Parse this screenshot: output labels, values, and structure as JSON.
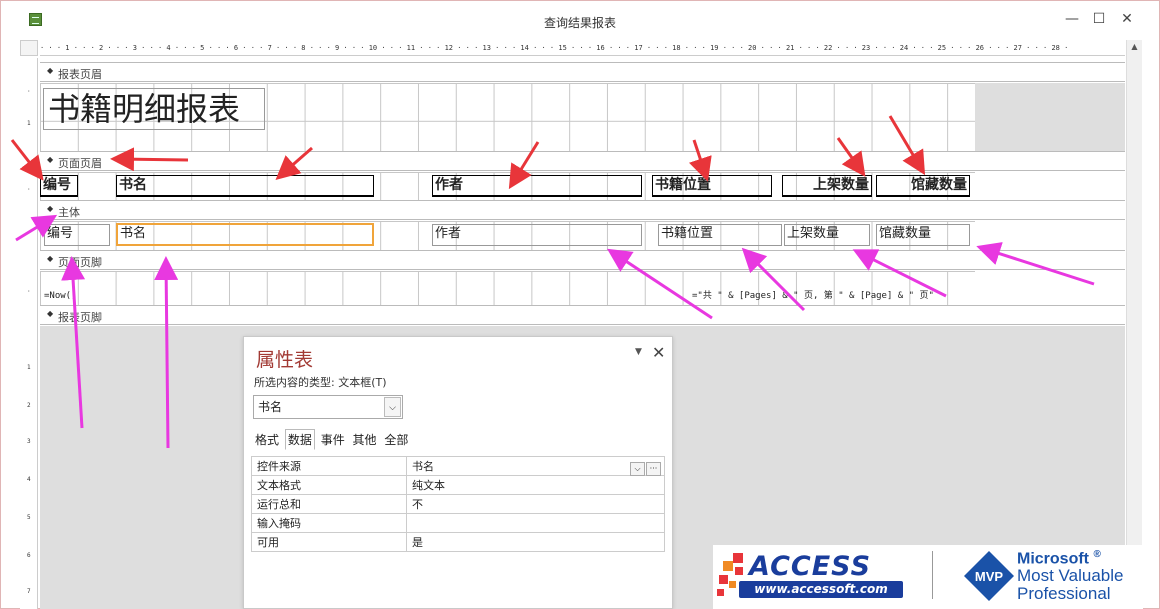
{
  "window": {
    "title": "查询结果报表",
    "minimize_glyph": "—",
    "maximize_glyph": "☐",
    "close_glyph": "✕"
  },
  "ruler": {
    "marks": "· · · 1 · · · 2 · · · 3 · · · 4 · · · 5 · · · 6 · · · 7 · · · 8 · · · 9 · · · 10 · · · 11 · · · 12 · · · 13 · · · 14 · · · 15 · · · 16 · · · 17 · · · 18 · · · 19 · · · 20 · · · 21 · · · 22 · · · 23 · · · 24 · · · 25 · · · 26 · · · 27 · · · 28 ·"
  },
  "sections": {
    "report_header": "报表页眉",
    "page_header": "页面页眉",
    "detail": "主体",
    "page_footer": "页面页脚",
    "report_footer": "报表页脚"
  },
  "report": {
    "title": "书籍明细报表"
  },
  "page_header_labels": {
    "id": "编号",
    "name": "书名",
    "author": "作者",
    "location": "书籍位置",
    "shelved": "上架数量",
    "stock": "馆藏数量"
  },
  "detail_fields": {
    "id": "编号",
    "name": "书名",
    "author": "作者",
    "location": "书籍位置",
    "shelved": "上架数量",
    "stock": "馆藏数量"
  },
  "page_footer": {
    "now_expr": "=Now()",
    "page_expr": "=\"共 \" & [Pages] & \" 页, 第 \" & [Page] & \" 页\""
  },
  "property_sheet": {
    "title": "属性表",
    "selection_type": "所选内容的类型: 文本框(T)",
    "selected_control": "书名",
    "pin_glyph": "▼",
    "close_glyph": "✕",
    "tabs": [
      "格式",
      "数据",
      "事件",
      "其他",
      "全部"
    ],
    "active_tab": "数据",
    "rows": [
      {
        "name": "控件来源",
        "value": "书名"
      },
      {
        "name": "文本格式",
        "value": "纯文本"
      },
      {
        "name": "运行总和",
        "value": "不"
      },
      {
        "name": "输入掩码",
        "value": ""
      },
      {
        "name": "可用",
        "value": "是"
      }
    ]
  },
  "branding": {
    "access_text": "ACCESS",
    "access_url": "www.accessoft.com",
    "ms_name": "Microsoft",
    "ms_reg": "®",
    "ms_line2": "Most Valuable",
    "ms_line3": "Professional",
    "mvp": "MVP"
  },
  "colors": {
    "annotation_red": "#e8353a",
    "annotation_magenta": "#e838e0",
    "selection_orange": "#f0a43a",
    "title_red": "#a23a34",
    "brand_blue": "#1a3d9c"
  }
}
